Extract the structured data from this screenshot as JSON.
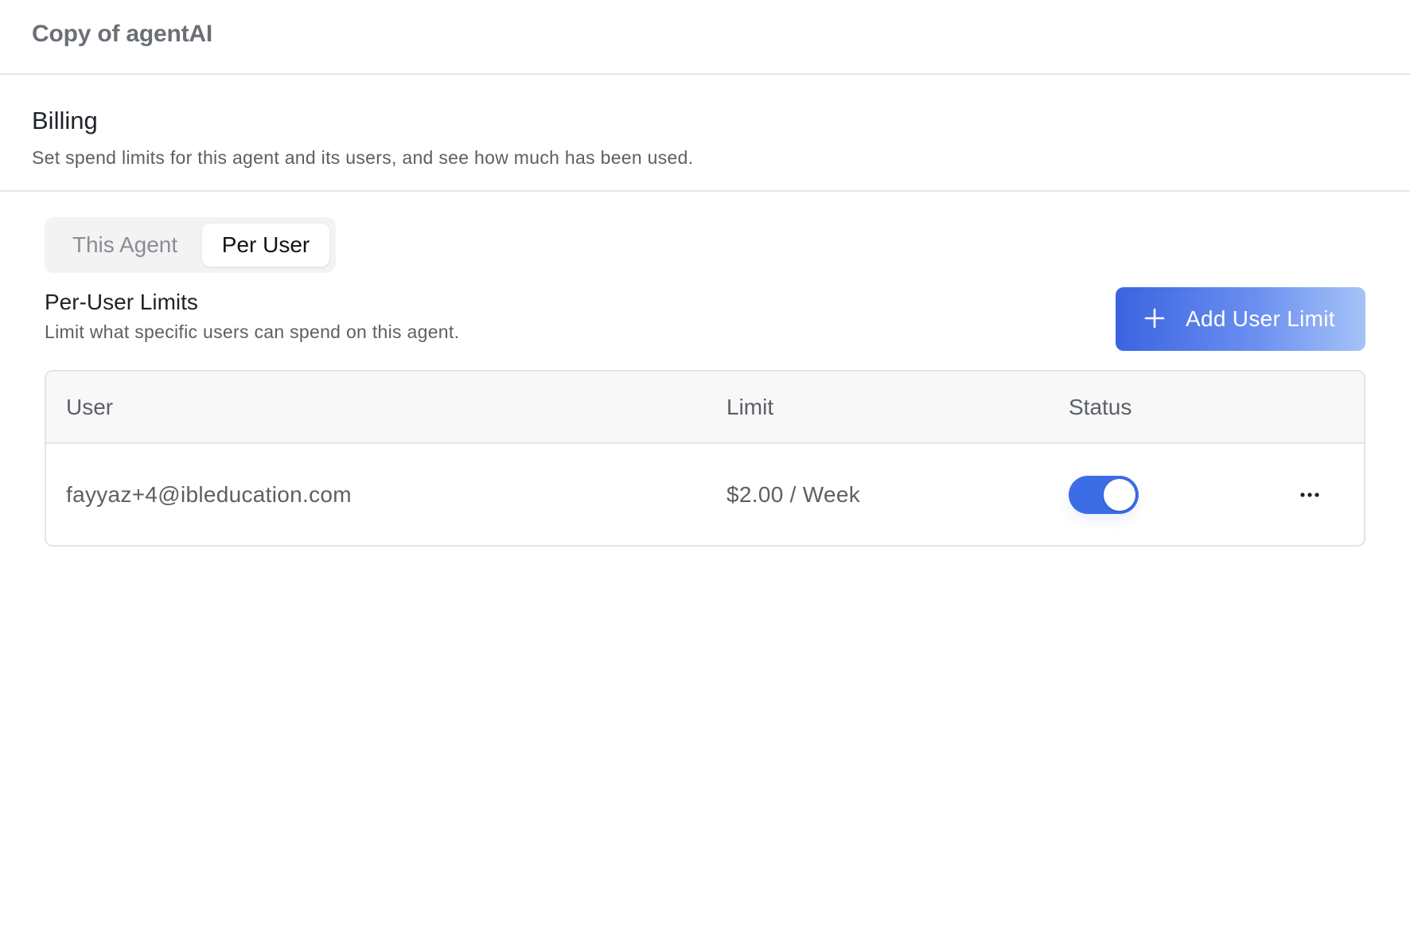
{
  "header": {
    "title": "Copy of agentAI"
  },
  "billing": {
    "title": "Billing",
    "subtitle": "Set spend limits for this agent and its users, and see how much has been used."
  },
  "tabs": [
    {
      "label": "This Agent",
      "active": false
    },
    {
      "label": "Per User",
      "active": true
    }
  ],
  "per_user": {
    "title": "Per-User Limits",
    "subtitle": "Limit what specific users can spend on this agent.",
    "add_button_label": "Add User Limit",
    "add_button_icon": "plus-icon"
  },
  "table": {
    "columns": [
      "User",
      "Limit",
      "Status"
    ],
    "rows": [
      {
        "user": "fayyaz+4@ibleducation.com",
        "limit": "$2.00 / Week",
        "status_enabled": true
      }
    ]
  },
  "colors": {
    "accent": "#3c6ce6",
    "button_gradient_start": "#3a64e0",
    "button_gradient_end": "#a6c3f7"
  }
}
